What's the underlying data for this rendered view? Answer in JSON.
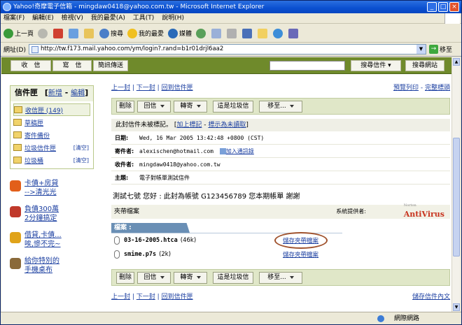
{
  "window": {
    "title": "Yahoo!奇摩電子信箱 - mingdaw0418@yahoo.com.tw - Microsoft Internet Explorer",
    "btn_min": "_",
    "btn_max": "□",
    "btn_close": "×"
  },
  "menu": [
    "檔案(F)",
    "編輯(E)",
    "檢視(V)",
    "我的最愛(A)",
    "工具(T)",
    "說明(H)"
  ],
  "toolbar": {
    "back": "上一頁",
    "search": "搜尋",
    "favorites": "我的最愛",
    "media": "媒體"
  },
  "address": {
    "label": "網址(D)",
    "url": "http://tw.f173.mail.yahoo.com/ym/login?.rand=b1r01drjl6aa2",
    "go": "移至"
  },
  "ybar": {
    "tabs": [
      "收　信",
      "寫　信",
      "簡訊傳送"
    ],
    "search_mail": "搜尋信件",
    "search_web": "搜尋網站"
  },
  "folders": {
    "title": "信件匣",
    "new": "新增",
    "edit": "編輯",
    "items": [
      {
        "label": "收信匣 (149)",
        "side": ""
      },
      {
        "label": "草稿匣",
        "side": ""
      },
      {
        "label": "寄件備份",
        "side": ""
      },
      {
        "label": "垃圾信件匣",
        "side": "[清空]"
      },
      {
        "label": "垃圾桶",
        "side": "[清空]"
      }
    ]
  },
  "ads": [
    {
      "line1": "卡債+房貸",
      "line2": "-->清光光",
      "color": "#e25f1a"
    },
    {
      "line1": "負債300萬",
      "line2": "2分鐘搞定",
      "color": "#c0392b"
    },
    {
      "line1": "借貸,卡債...",
      "line2": "唉,慘不完~",
      "color": "#e0a31a"
    },
    {
      "line1": "給你特別的",
      "line2": "手機桌布",
      "color": "#8a6a3a"
    }
  ],
  "nav": {
    "prev": "上一封",
    "next": "下一封",
    "back_list": "回到信件匣",
    "print": "預覽列印",
    "full_header": "完整標頭",
    "save_all": "儲存信件內文"
  },
  "actions": {
    "delete": "刪除",
    "reply": "回信",
    "forward": "轉寄",
    "spam": "這是垃圾信",
    "move": "移至..."
  },
  "flag": {
    "text": "此封信件未被標記。",
    "add_flag": "加上標記",
    "mark_unread": "標示為未讀取"
  },
  "header": {
    "date_k": "日期:",
    "date_v": "Wed, 16 Mar 2005 13:42:48 +0800 (CST)",
    "from_k": "寄件者:",
    "from_v": "alexischen@hotmail.com",
    "add_contact": "加入通訊錄",
    "to_k": "收件者:",
    "to_v": "mingdaw0418@yahoo.com.tw",
    "subject_k": "主題:",
    "subject_v": "電子對帳單測試信件"
  },
  "body": "測試七號 您好 : 此封為帳號 G123456789 您本期帳單 謝謝",
  "attach": {
    "section": "夾帶檔案",
    "provider": "系統提供者:",
    "brand_top": "Norton",
    "brand": "AntiVirus",
    "band": "檔案 :",
    "files": [
      {
        "name": "03-16-2005.htca",
        "size": "(46k)",
        "action": "儲存夾帶檔案"
      },
      {
        "name": "smime.p7s",
        "size": "(2k)",
        "action": "儲存夾帶檔案"
      }
    ]
  },
  "status": {
    "zone": "網際網路"
  }
}
